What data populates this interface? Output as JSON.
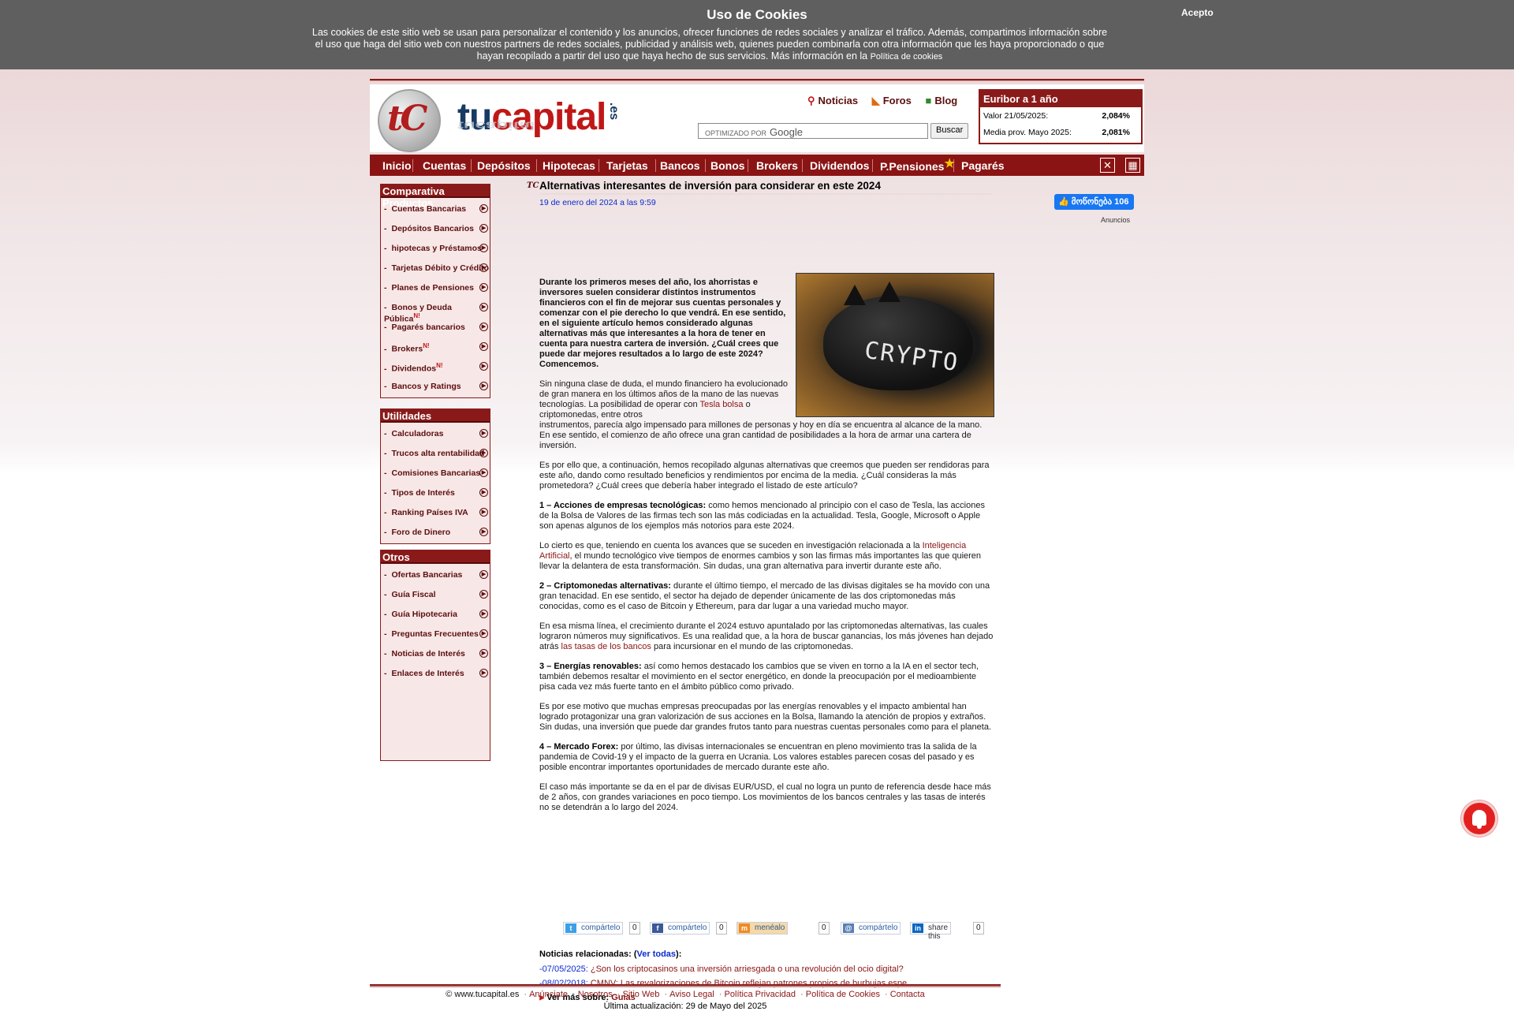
{
  "cookie": {
    "title": "Uso de Cookies",
    "text": "Las cookies de este sitio web se usan para personalizar el contenido y los anuncios, ofrecer funciones de redes sociales y analizar el tráfico. Además, compartimos información sobre el uso que haga del sitio web con nuestros partners de redes sociales, publicidad y análisis web, quienes pueden combinarla con otra información que les haya proporcionado o que hayan recopilado a partir del uso que haya hecho de sus servicios. Más información en la",
    "link": "Política de cookies",
    "accept": "Acepto"
  },
  "header": {
    "logo_tu": "tu",
    "logo_capital": "capital",
    "logo_es": ".es",
    "logo_mark": "tC",
    "links": [
      "Noticias",
      "Foros",
      "Blog"
    ],
    "search_label": "OPTIMIZADO POR",
    "search_brand": "Google",
    "search_button": "Buscar"
  },
  "euribor": {
    "title": "Euribor a 1 año",
    "rows": [
      {
        "label": "Valor 21/05/2025:",
        "value": "2,084%"
      },
      {
        "label": "Media prov. Mayo 2025:",
        "value": "2,081%"
      }
    ]
  },
  "nav": [
    "Inicio",
    "Cuentas",
    "Depósitos",
    "Hipotecas",
    "Tarjetas",
    "Bancos",
    "Bonos",
    "Brokers",
    "Dividendos",
    "P.Pensiones",
    "Pagarés"
  ],
  "sidebar": {
    "products": {
      "title": "Comparativa Productos",
      "items": [
        "Cuentas Bancarias",
        "Depósitos Bancarios",
        "hipotecas y Préstamos",
        "Tarjetas Débito y Crédito",
        "Planes de Pensiones",
        "Bonos y Deuda Pública",
        "Pagarés bancarios",
        "Brokers",
        "Dividendos",
        "Bancos y Ratings"
      ],
      "new_badge": "N!"
    },
    "utilities": {
      "title": "Utilidades",
      "items": [
        "Calculadoras",
        "Trucos alta rentabilidad",
        "Comisiones Bancarias",
        "Tipos de Interés",
        "Ranking Países IVA",
        "Foro de Dinero"
      ]
    },
    "others": {
      "title": "Otros",
      "items": [
        "Ofertas Bancarias",
        "Guía Fiscal",
        "Guía Hipotecaria",
        "Preguntas Frecuentes",
        "Noticias de Interés",
        "Enlaces de Interés"
      ]
    }
  },
  "article": {
    "mark": "TC",
    "title": "Alternativas interesantes de inversión para considerar en este 2024",
    "date": "19 de enero del 2024 a las 9:59",
    "image_text": "CRYPTO",
    "lead": "Durante los primeros meses del año, los ahorristas e inversores suelen considerar distintos instrumentos financieros con el fin de mejorar sus cuentas personales y comenzar con el pie derecho lo que vendrá. En ese sentido, en el siguiente artículo hemos considerado algunas alternativas más que interesantes a la hora de tener en cuenta para nuestra cartera de inversión. ¿Cuál crees que puede dar mejores resultados a lo largo de este 2024? Comencemos.",
    "p1a": "Sin ninguna clase de duda, el mundo financiero ha evolucionado de gran manera en los últimos años de la mano de las nuevas tecnologías. La posibilidad de operar con",
    "p1_link": "Tesla bolsa",
    "p1b": "o criptomonedas, entre otros",
    "p1c": "instrumentos, parecía algo impensado para millones de personas y hoy en día se encuentra al alcance de la mano. En ese sentido, el comienzo de año ofrece una gran cantidad de posibilidades a la hora de armar una cartera de inversión.",
    "p2": "Es por ello que, a continuación, hemos recopilado algunas alternativas que creemos que pueden ser rendidoras para este año, dando como resultado beneficios y rendimientos por encima de la media. ¿Cuál consideras la más prometedora? ¿Cuál crees que debería haber integrado el listado de este artículo?",
    "s1_title": "1 – Acciones de empresas tecnológicas:",
    "s1": "como hemos mencionado al principio con el caso de Tesla, las acciones de la Bolsa de Valores de las firmas tech son las más codiciadas en la actualidad. Tesla, Google, Microsoft o Apple son apenas algunos de los ejemplos más notorios para este 2024.",
    "p3a": "Lo cierto es que, teniendo en cuenta los avances que se suceden en investigación relacionada a la",
    "p3_link": "Inteligencia Artificial",
    "p3b": ", el mundo tecnológico vive tiempos de enormes cambios y son las firmas más importantes las que quieren llevar la delantera de esta transformación. Sin dudas, una gran alternativa para invertir durante este año.",
    "s2_title": "2 – Criptomonedas alternativas:",
    "s2": "durante el último tiempo, el mercado de las divisas digitales se ha movido con una gran tenacidad. En ese sentido, el sector ha dejado de depender únicamente de las dos criptomonedas más conocidas, como es el caso de Bitcoin y Ethereum, para dar lugar a una variedad mucho mayor.",
    "p4a": "En esa misma línea, el crecimiento durante el 2024 estuvo apuntalado por las criptomonedas alternativas, las cuales lograron números muy significativos. Es una realidad que, a la hora de buscar ganancias, los más jóvenes han dejado atrás",
    "p4_link": "las tasas de los bancos",
    "p4b": "para incursionar en el mundo de las criptomonedas.",
    "s3_title": "3 – Energías renovables:",
    "s3": "así como hemos destacado los cambios que se viven en torno a la IA en el sector tech, también debemos resaltar el movimiento en el sector energético, en donde la preocupación por el medioambiente pisa cada vez más fuerte tanto en el ámbito público como privado.",
    "p5": "Es por ese motivo que muchas empresas preocupadas por las energías renovables y el impacto ambiental han logrado protagonizar una gran valorización de sus acciones en la Bolsa, llamando la atención de propios y extraños. Sin dudas, una inversión que puede dar grandes frutos tanto para nuestras cuentas personales como para el planeta.",
    "s4_title": "4 – Mercado Forex:",
    "s4": "por último, las divisas internacionales se encuentran en pleno movimiento tras la salida de la pandemia de Covid-19 y el impacto de la guerra en Ucrania. Los valores estables parecen cosas del pasado y es posible encontrar importantes oportunidades de mercado durante este año.",
    "p6": "El caso más importante se da en el par de divisas EUR/USD, el cual no logra un punto de referencia desde hace más de 2 años, con grandes variaciones en poco tiempo. Los movimientos de los bancos centrales y las tasas de interés no se detendrán a lo largo del 2024."
  },
  "share": [
    {
      "label": "compártelo",
      "count": "0",
      "icon": "twitter-icon",
      "color": "#3aa0e8"
    },
    {
      "label": "compártelo",
      "count": "0",
      "icon": "facebook-icon",
      "color": "#3b5998"
    },
    {
      "label": "menéalo",
      "count": "0",
      "icon": "meneame-icon",
      "color": "#f08a24"
    },
    {
      "label": "compártelo",
      "count": "",
      "icon": "share-icon",
      "color": "#5a7fb5"
    },
    {
      "label": "share this",
      "count": "0",
      "icon": "linkedin-icon",
      "color": "#0a66c2"
    }
  ],
  "related": {
    "title": "Noticias relacionadas:",
    "see_all": "Ver todas",
    "items": [
      {
        "date": "-07/05/2025:",
        "text": "¿Son los criptocasinos una inversión arriesgada o una revolución del ocio digital?"
      },
      {
        "date": "-08/02/2018:",
        "text": "CMNV: Las revalorizaciones de Bitcoin reflejan patrones propios de burbujas espe..."
      }
    ],
    "more_label": "Ver más sobre:",
    "more_link": "Guías"
  },
  "right": {
    "fb_like": "მოწონება 106",
    "ads": "Anuncios"
  },
  "footer": {
    "copyright": "© www.tucapital.es",
    "links": [
      "Anúnciate",
      "Nosotros",
      "Sitio Web",
      "Aviso Legal",
      "Política Privacidad",
      "Política de Cookies",
      "Contacta"
    ],
    "updated": "Última actualización: 29 de Mayo del 2025"
  }
}
